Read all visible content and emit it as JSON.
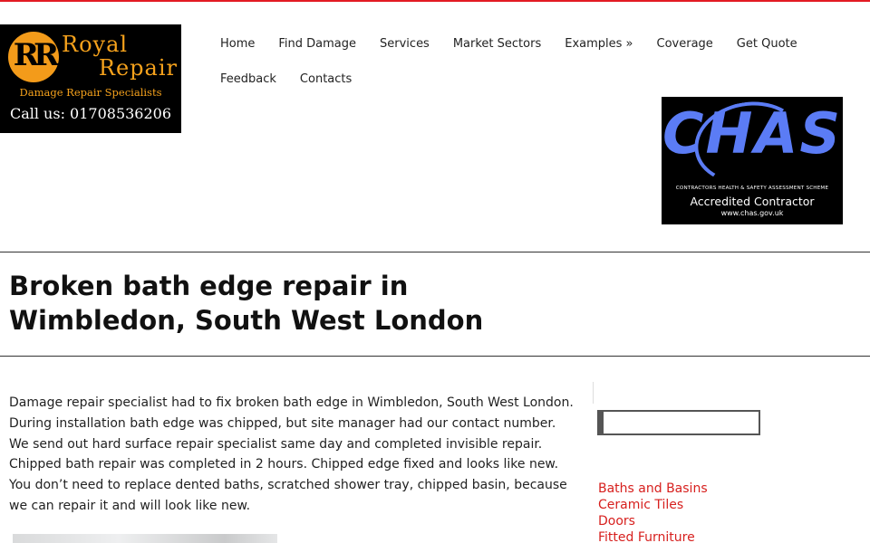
{
  "brand": {
    "line1": "Royal",
    "line2": "Repair",
    "tagline": "Damage Repair Specialists",
    "phone": "Call us: 01708536206",
    "colors": {
      "accent": "#e31b23",
      "logo_orange": "#f6a21c",
      "link_red": "#d7201e"
    }
  },
  "nav": {
    "items": [
      {
        "label": "Home"
      },
      {
        "label": "Find Damage"
      },
      {
        "label": "Services"
      },
      {
        "label": "Market Sectors"
      },
      {
        "label": "Examples »"
      },
      {
        "label": "Coverage"
      },
      {
        "label": "Get Quote"
      },
      {
        "label": "Feedback"
      },
      {
        "label": "Contacts"
      }
    ]
  },
  "badge": {
    "logo": "CHAS",
    "scheme": "CONTRACTORS HEALTH & SAFETY ASSESSMENT SCHEME",
    "status": "Accredited Contractor",
    "url": "www.chas.gov.uk"
  },
  "page": {
    "title": "Broken bath edge repair in Wimbledon, South West London",
    "body": "Damage repair specialist had to fix broken bath edge in Wimbledon, South West London. During installation bath edge was chipped, but site manager had our contact number. We send out hard surface repair specialist same day and completed invisible repair. Chipped bath repair was completed in 2 hours.  Chipped edge fixed and looks like new. You don’t need to replace dented baths, scratched shower tray, chipped basin, because we can repair it and will look like new."
  },
  "sidebar": {
    "search": {
      "placeholder": ""
    },
    "categories": [
      {
        "label": "Baths and Basins"
      },
      {
        "label": "Ceramic Tiles"
      },
      {
        "label": "Doors"
      },
      {
        "label": "Fitted Furniture"
      }
    ]
  }
}
